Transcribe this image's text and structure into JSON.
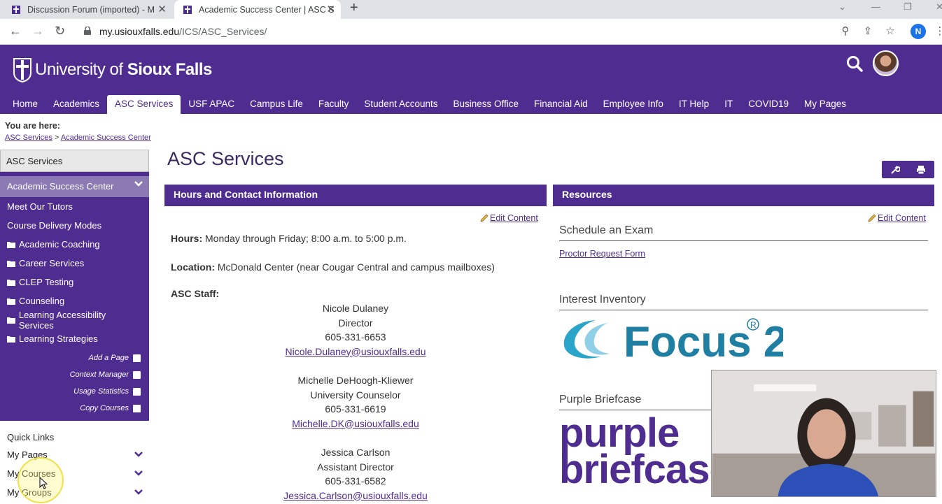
{
  "browser": {
    "tabs": [
      {
        "title": "Discussion Forum (imported) - M",
        "active": false
      },
      {
        "title": "Academic Success Center | ASC S",
        "active": true
      }
    ],
    "url_host": "my.usiouxfalls.edu",
    "url_path": "/ICS/ASC_Services/",
    "profile_initial": "N",
    "icons": [
      "back-icon",
      "forward-icon",
      "reload-icon",
      "lock-icon",
      "zoom-icon",
      "share-icon",
      "star-icon"
    ]
  },
  "site": {
    "logo_prefix": "University of ",
    "logo_bold": "Sioux Falls",
    "nav": [
      "Home",
      "Academics",
      "ASC Services",
      "USF APAC",
      "Campus Life",
      "Faculty",
      "Student Accounts",
      "Business Office",
      "Financial Aid",
      "Employee Info",
      "IT Help",
      "IT",
      "COVID19",
      "My Pages"
    ],
    "nav_active": "ASC Services",
    "brand_color": "#4f2c8f"
  },
  "breadcrumb": {
    "label": "You are here:",
    "items": [
      "ASC Services",
      "Academic Success Center"
    ],
    "separator": ">"
  },
  "sidebar": {
    "heading": "ASC Services",
    "current": "Academic Success Center",
    "items": [
      {
        "label": "Meet Our Tutors",
        "folder": false
      },
      {
        "label": "Course Delivery Modes",
        "folder": false
      },
      {
        "label": "Academic Coaching",
        "folder": true
      },
      {
        "label": "Career Services",
        "folder": true
      },
      {
        "label": "CLEP Testing",
        "folder": true
      },
      {
        "label": "Counseling",
        "folder": true
      },
      {
        "label": "Learning Accessibility Services",
        "folder": true
      },
      {
        "label": "Learning Strategies",
        "folder": true
      }
    ],
    "tools": [
      "Add a Page",
      "Context Manager",
      "Usage Statistics",
      "Copy Courses"
    ]
  },
  "quick_links": {
    "heading": "Quick Links",
    "items": [
      "My Pages",
      "My Courses",
      "My Groups"
    ]
  },
  "main": {
    "title": "ASC Services",
    "hours_panel": {
      "heading": "Hours and Contact Information",
      "edit": "Edit Content",
      "hours_label": "Hours:",
      "hours_value": "Monday through Friday; 8:00 a.m. to 5:00 p.m.",
      "location_label": "Location:",
      "location_value": "McDonald Center (near Cougar Central and campus mailboxes)",
      "staff_label": "ASC Staff:",
      "staff": [
        {
          "name": "Nicole Dulaney",
          "title": "Director",
          "phone": "605-331-6653",
          "email": "Nicole.Dulaney@usiouxfalls.edu"
        },
        {
          "name": "Michelle DeHoogh-Kliewer",
          "title": "University Counselor",
          "phone": "605-331-6619",
          "email": "Michelle.DK@usiouxfalls.edu"
        },
        {
          "name": "Jessica Carlson",
          "title": "Assistant Director",
          "phone": "605-331-6582",
          "email": "Jessica.Carlson@usiouxfalls.edu"
        }
      ]
    },
    "resources_panel": {
      "heading": "Resources",
      "edit": "Edit Content",
      "sections": [
        {
          "title": "Schedule an Exam",
          "link": "Proctor Request Form"
        },
        {
          "title": "Interest Inventory",
          "logo_text": "Focus 2"
        },
        {
          "title": "Purple Briefcase",
          "logo_text": "purple briefcase"
        }
      ]
    }
  }
}
